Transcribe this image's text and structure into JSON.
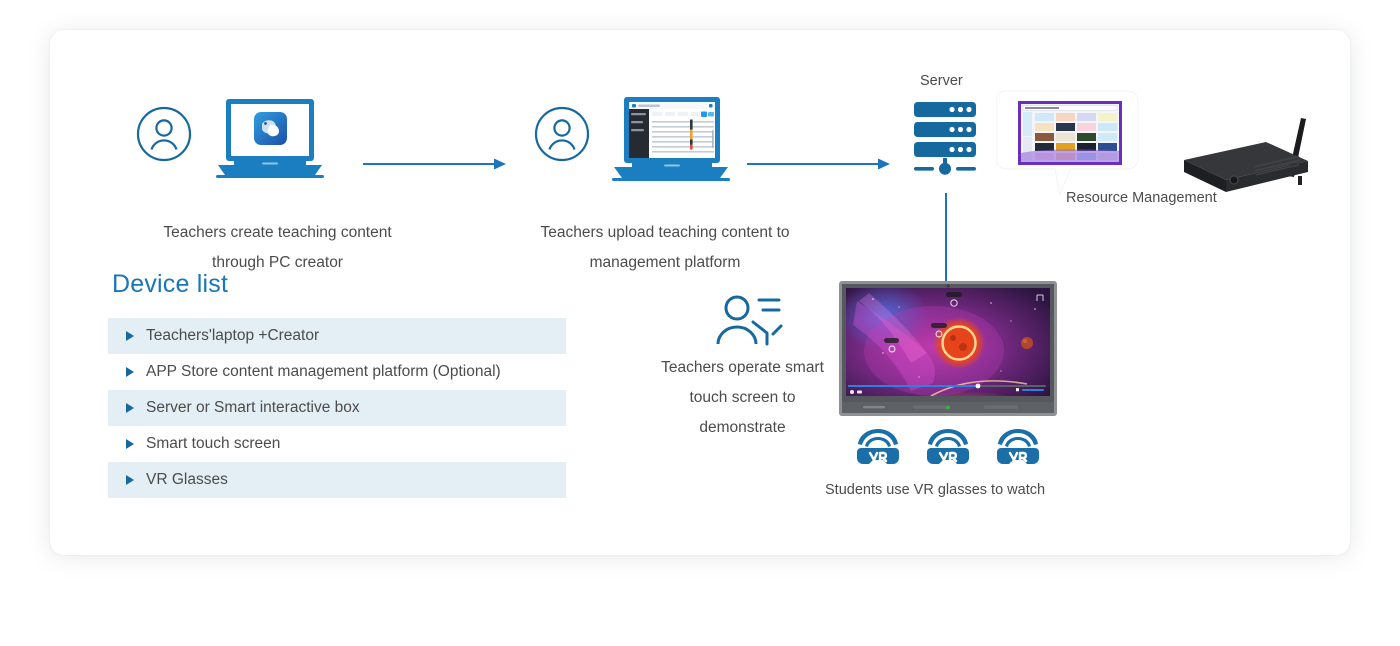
{
  "page": {
    "background": "#ffffff",
    "card_background": "#ffffff",
    "accent_blue": "#1b75bb",
    "icon_blue": "#15699f",
    "text_color": "#4c4c4c",
    "row_highlight": "#e3eef5"
  },
  "flow": {
    "step1": {
      "caption_line1": "Teachers create teaching content",
      "caption_line2": "through PC creator",
      "avatar_icon": "user-circle-icon",
      "device_icon": "laptop-creator-icon"
    },
    "step2": {
      "caption_line1": "Teachers upload teaching content to",
      "caption_line2": "management platform",
      "avatar_icon": "user-circle-icon",
      "device_icon": "laptop-dashboard-icon"
    },
    "server": {
      "label": "Server",
      "icon": "server-stack-icon"
    },
    "resource": {
      "label": "Resource Management",
      "icon": "resource-grid-bubble-icon"
    },
    "smartbox": {
      "icon": "smart-interactive-box-icon"
    },
    "operate": {
      "caption_line1": "Teachers operate smart",
      "caption_line2": "touch screen to",
      "caption_line3": "demonstrate",
      "icon": "presenter-person-icon"
    },
    "touchscreen": {
      "icon": "smart-touch-screen-icon",
      "scene": "space-nebula-video"
    },
    "students": {
      "caption": "Students use VR glasses to watch",
      "glasses_icon": "vr-glasses-icon",
      "glasses_count": 3
    },
    "arrows": {
      "arrow1": "arrow-right-icon",
      "arrow2": "arrow-right-icon",
      "arrow3": "arrow-down-icon"
    }
  },
  "device_list": {
    "title": "Device list",
    "items": [
      {
        "label": "Teachers'laptop +Creator",
        "highlighted": true
      },
      {
        "label": "APP Store content management platform (Optional)",
        "highlighted": false
      },
      {
        "label": "Server or Smart interactive box",
        "highlighted": true
      },
      {
        "label": "Smart touch screen",
        "highlighted": false
      },
      {
        "label": "VR Glasses",
        "highlighted": true
      }
    ]
  }
}
